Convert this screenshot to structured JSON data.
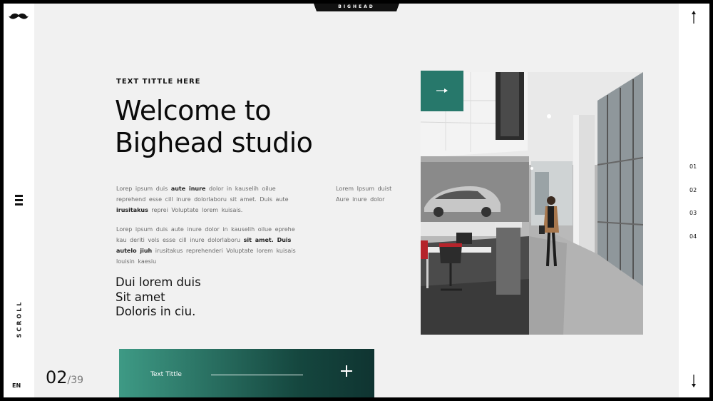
{
  "brand": "BIGHEAD",
  "sidebar": {
    "scroll_label": "SCROLL",
    "language": "EN"
  },
  "hero": {
    "kicker": "TEXT TITTLE HERE",
    "headline_line1": "Welcome to",
    "headline_line2": "Bighead studio",
    "paragraph1": {
      "t1": "Lorep  ipsum duis ",
      "b1": "aute inure",
      "t2": " dolor in kauselih oilue reprehend esse cill inure dolorlaboru  sit amet. Duis aute ",
      "b2": "irusitakus",
      "t3": "  reprei Voluptate  lorem kuisais."
    },
    "paragraph2": {
      "t1": "Lorep  ipsum duis aute inure dolor in kauselih oilue eprehe kau deriti vols esse cill inure dolorlaboru  ",
      "b1": "sit amet. Duis autelo jiuh",
      "t2": " irusitakus reprehenderi Voluptate lorem kuisais louisin kaesiu"
    },
    "paragraph3": "Lorem Ipsum  duist Aure inure dolor",
    "tagline_line1": "Dui lorem duis",
    "tagline_line2": "Sit amet",
    "tagline_line3": "Doloris in ciu."
  },
  "counter": {
    "current": "02",
    "total": "/39"
  },
  "card": {
    "title": "Text Tittle"
  },
  "pager": [
    "01",
    "02",
    "03",
    "04"
  ],
  "colors": {
    "accent": "#27786b",
    "accent_dark": "#0f3431",
    "background": "#f1f1f1"
  },
  "icons": [
    "mustache-logo-icon",
    "menu-icon",
    "arrow-right-icon",
    "plus-icon",
    "arrow-up-icon",
    "arrow-down-icon"
  ]
}
